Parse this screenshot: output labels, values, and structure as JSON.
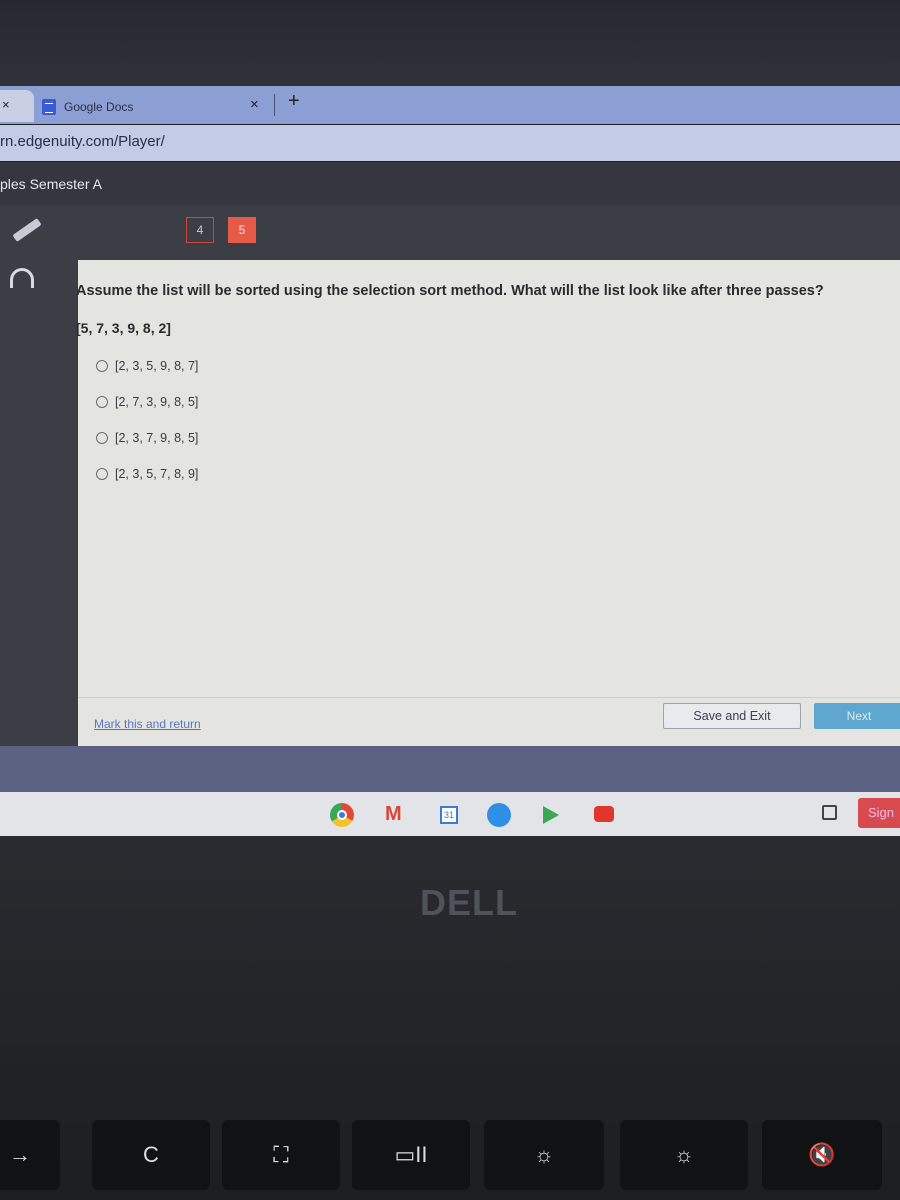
{
  "browser": {
    "prev_tab_close": "×",
    "tabs": [
      {
        "label": "Google Docs",
        "close": "×"
      }
    ],
    "new_tab": "+",
    "url": "rn.edgenuity.com/Player/"
  },
  "course": {
    "title": "ples Semester A"
  },
  "question_nav": {
    "items": [
      "4",
      "5"
    ],
    "current": "5"
  },
  "question": {
    "prompt": "Assume the list will be sorted using the selection sort method. What will the list look like after three passes?",
    "list": "[5, 7, 3, 9, 8, 2]",
    "options": [
      "[2, 3, 5, 9, 8, 7]",
      "[2, 7, 3, 9, 8, 5]",
      "[2, 3, 7, 9, 8, 5]",
      "[2, 3, 5, 7, 8, 9]"
    ]
  },
  "footer": {
    "mark_label": "Mark this and return",
    "save_label": "Save and Exit",
    "next_label": "Next"
  },
  "shelf": {
    "apps": [
      "chrome-icon",
      "gmail-icon",
      "calendar-icon",
      "files-icon",
      "play-store-icon",
      "youtube-icon"
    ],
    "calendar_day": "31",
    "sign_label": "Sign"
  },
  "laptop": {
    "brand": "DELL"
  },
  "keys": [
    "→",
    "C",
    "⛶",
    "▭II",
    "☼",
    "☼",
    "🔇"
  ],
  "colors": {
    "accent_red": "#e55b48",
    "next_blue": "#5fa7cf",
    "link": "#5a76c0"
  }
}
